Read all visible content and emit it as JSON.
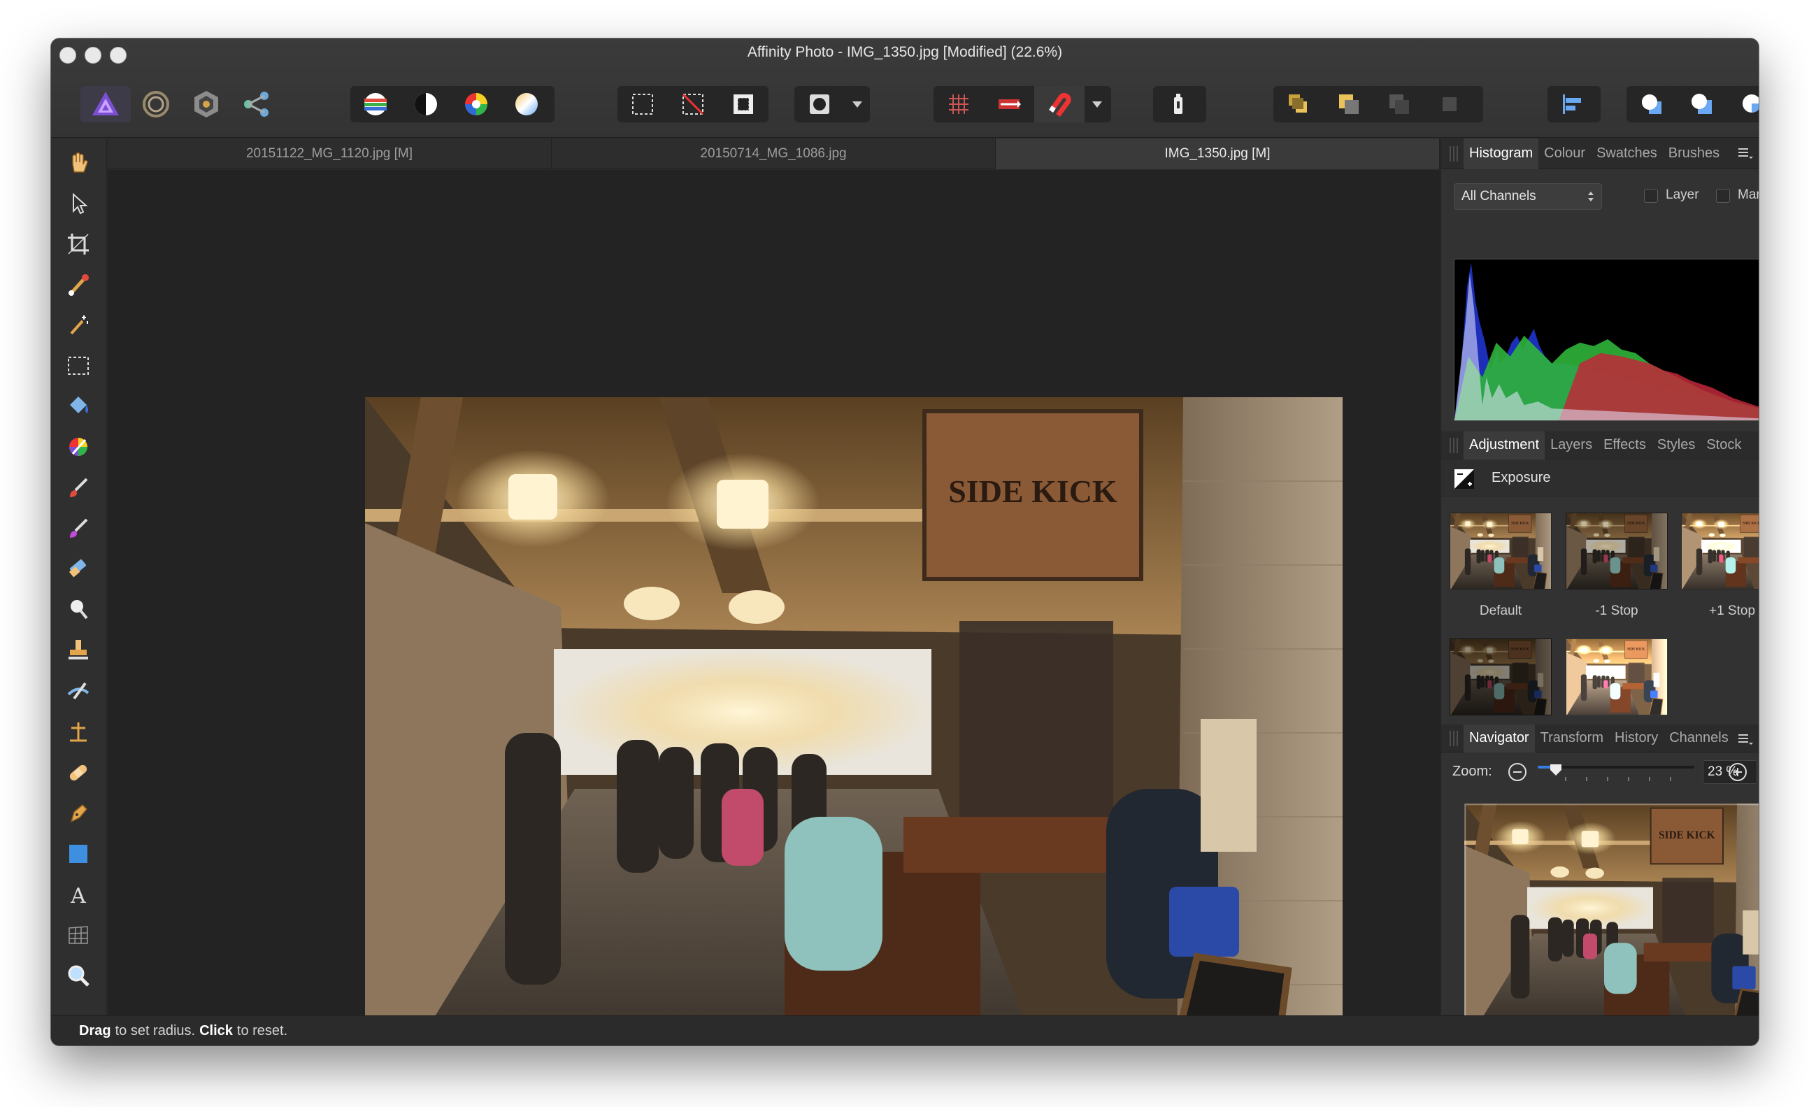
{
  "window": {
    "title": "Affinity Photo - IMG_1350.jpg [Modified] (22.6%)"
  },
  "doc_tabs": [
    {
      "label": "20151122_MG_1120.jpg [M]"
    },
    {
      "label": "20150714_MG_1086.jpg"
    },
    {
      "label": "IMG_1350.jpg [M]"
    }
  ],
  "personas": [
    "photo-persona-icon",
    "liquify-persona-icon",
    "develop-persona-icon",
    "export-persona-icon"
  ],
  "tools": [
    "hand-tool-icon",
    "move-tool-icon",
    "crop-tool-icon",
    "selection-brush-icon",
    "flood-select-icon",
    "marquee-tool-icon",
    "flood-fill-icon",
    "colour-picker-icon",
    "paint-brush-icon",
    "mixer-brush-icon",
    "erase-brush-icon",
    "dodge-brush-icon",
    "clone-brush-icon",
    "smudge-brush-icon",
    "perspective-tool-icon",
    "healing-brush-icon",
    "pen-tool-icon",
    "rectangle-tool-icon",
    "text-tool-icon",
    "mesh-warp-icon",
    "zoom-tool-icon"
  ],
  "histogram_panel": {
    "tabs": [
      "Histogram",
      "Colour",
      "Swatches",
      "Brushes"
    ],
    "active_tab": "Histogram",
    "channel_select": "All Channels",
    "layer_label": "Layer",
    "marquee_label": "Marquee"
  },
  "adjustment_panel": {
    "tabs": [
      "Adjustment",
      "Layers",
      "Effects",
      "Styles",
      "Stock"
    ],
    "active_tab": "Adjustment",
    "adjustment_name": "Exposure",
    "presets": [
      {
        "label": "Default",
        "brightness": 1.0
      },
      {
        "label": "-1 Stop",
        "brightness": 0.75
      },
      {
        "label": "+1 Stop",
        "brightness": 1.25
      },
      {
        "label": "",
        "brightness": 0.55
      },
      {
        "label": "",
        "brightness": 1.7
      }
    ]
  },
  "navigator_panel": {
    "tabs": [
      "Navigator",
      "Transform",
      "History",
      "Channels"
    ],
    "active_tab": "Navigator",
    "zoom_label": "Zoom:",
    "zoom_value": "23 %"
  },
  "status": {
    "drag": "Drag",
    "drag_text": "to set radius.",
    "click": "Click",
    "click_text": "to reset."
  },
  "colors": {
    "accent": "#7a4fd1",
    "window_bg": "#2b2b2b",
    "canvas_bg": "#232323",
    "panel_bg": "#323232"
  }
}
